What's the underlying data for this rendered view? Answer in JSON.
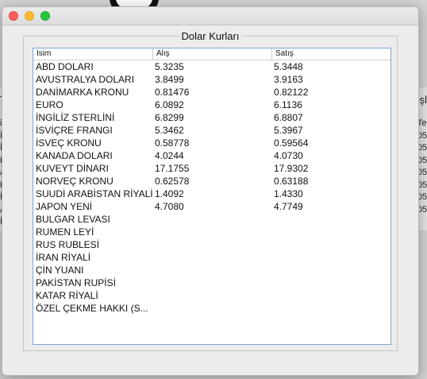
{
  "background": {
    "left_header": "Te",
    "left_rows": [
      "isi",
      "İR",
      "İR",
      "Kı",
      "AY",
      "Kı",
      "İR",
      "AL",
      "İR"
    ],
    "right_header": "şl",
    "right_rows": [
      "Te",
      "05",
      "05",
      "05",
      "05",
      "05",
      "05",
      "05"
    ]
  },
  "dialog": {
    "group_title": "Dolar Kurları",
    "columns": [
      "Isim",
      "Alış",
      "Satış"
    ],
    "rows": [
      [
        "ABD DOLARI",
        "5.3235",
        "5.3448"
      ],
      [
        "AVUSTRALYA DOLARI",
        "3.8499",
        "3.9163"
      ],
      [
        "DANİMARKA KRONU",
        "0.81476",
        "0.82122"
      ],
      [
        "EURO",
        "6.0892",
        "6.1136"
      ],
      [
        "İNGİLİZ STERLİNİ",
        "6.8299",
        "6.8807"
      ],
      [
        "İSVİÇRE FRANGI",
        "5.3462",
        "5.3967"
      ],
      [
        "İSVEÇ KRONU",
        "0.58778",
        "0.59564"
      ],
      [
        "KANADA DOLARI",
        "4.0244",
        "4.0730"
      ],
      [
        "KUVEYT DİNARI",
        "17.1755",
        "17.9302"
      ],
      [
        "NORVEÇ KRONU",
        "0.62578",
        "0.63188"
      ],
      [
        "SUUDİ ARABİSTAN RİYALİ",
        "1.4092",
        "1.4330"
      ],
      [
        "JAPON YENİ",
        "4.7080",
        "4.7749"
      ],
      [
        "BULGAR LEVASI",
        "",
        ""
      ],
      [
        "RUMEN LEYİ",
        "",
        ""
      ],
      [
        "RUS RUBLESİ",
        "",
        ""
      ],
      [
        "İRAN RİYALİ",
        "",
        ""
      ],
      [
        "ÇİN YUANI",
        "",
        ""
      ],
      [
        "PAKİSTAN RUPİSİ",
        "",
        ""
      ],
      [
        "KATAR RİYALİ",
        "",
        ""
      ],
      [
        "ÖZEL ÇEKME HAKKI (S...",
        "",
        ""
      ]
    ]
  }
}
